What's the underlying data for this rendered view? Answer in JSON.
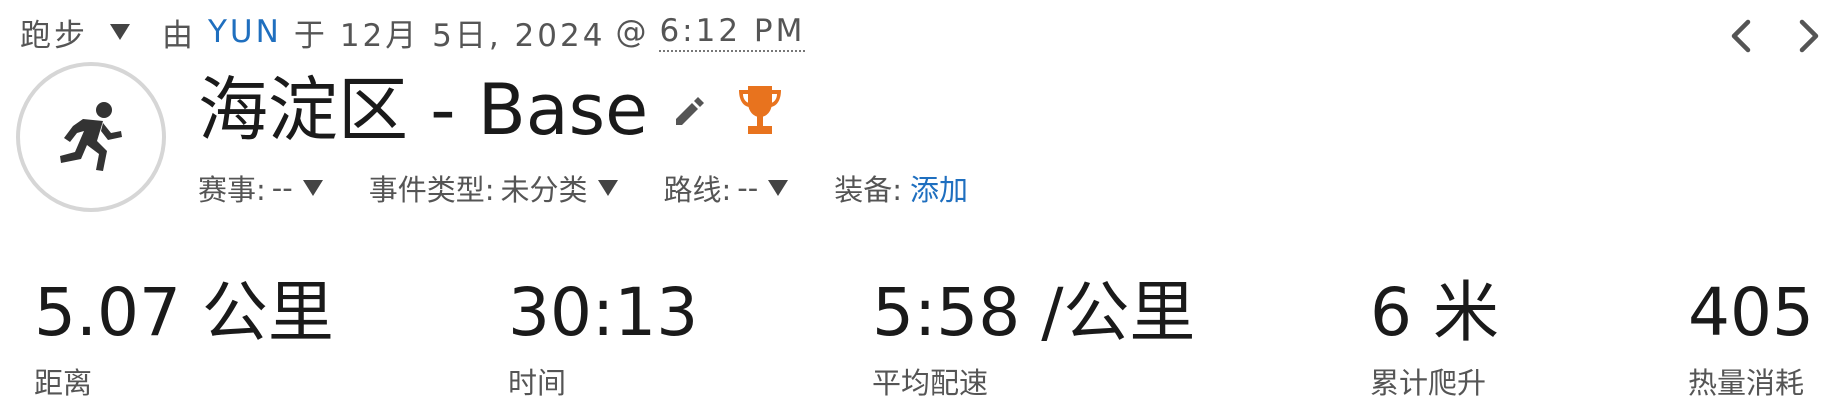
{
  "header": {
    "sport": "跑步",
    "by": "由",
    "user": "YUN",
    "on": "于",
    "date": "12月 5日, 2024",
    "at": "@",
    "time": "6:12 PM"
  },
  "icons": {
    "avatar": "runner-icon",
    "edit": "pencil-icon",
    "trophy": "trophy-icon",
    "prev": "chevron-left-icon",
    "next": "chevron-right-icon"
  },
  "colors": {
    "link": "#1f6fbf",
    "trophy": "#e8731e",
    "text": "#1a1a1a",
    "muted": "#555555"
  },
  "activity": {
    "title": "海淀区 - Base"
  },
  "attributes": {
    "race_label": "赛事:",
    "race_value": "--",
    "event_type_label": "事件类型:",
    "event_type_value": "未分类",
    "route_label": "路线:",
    "route_value": "--",
    "gear_label": "装备:",
    "gear_link": "添加"
  },
  "stats": [
    {
      "value": "5.07 公里",
      "label": "距离"
    },
    {
      "value": "30:13",
      "label": "时间"
    },
    {
      "value": "5:58 /公里",
      "label": "平均配速"
    },
    {
      "value": "6 米",
      "label": "累计爬升"
    },
    {
      "value": "405",
      "label": "热量消耗"
    }
  ]
}
